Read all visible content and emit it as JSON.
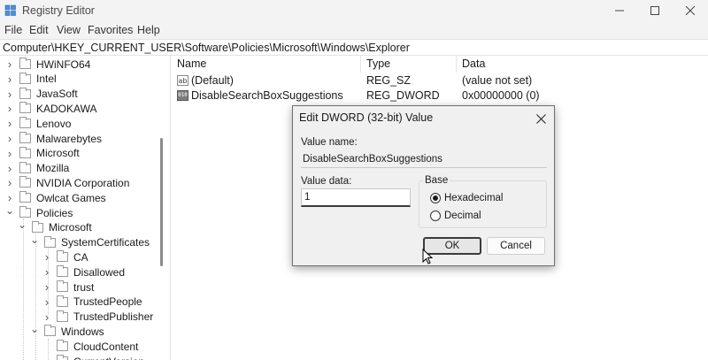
{
  "window": {
    "title": "Registry Editor",
    "minimize_glyph": "—",
    "maximize_glyph": "☐",
    "close_glyph": "✕"
  },
  "menu": [
    "File",
    "Edit",
    "View",
    "Favorites",
    "Help"
  ],
  "address": "Computer\\HKEY_CURRENT_USER\\Software\\Policies\\Microsoft\\Windows\\Explorer",
  "tree": {
    "items": [
      {
        "label": "HWiNFO64",
        "level": 1,
        "state": "collapsed"
      },
      {
        "label": "Intel",
        "level": 1,
        "state": "collapsed"
      },
      {
        "label": "JavaSoft",
        "level": 1,
        "state": "collapsed"
      },
      {
        "label": "KADOKAWA",
        "level": 1,
        "state": "collapsed"
      },
      {
        "label": "Lenovo",
        "level": 1,
        "state": "collapsed"
      },
      {
        "label": "Malwarebytes",
        "level": 1,
        "state": "collapsed"
      },
      {
        "label": "Microsoft",
        "level": 1,
        "state": "collapsed"
      },
      {
        "label": "Mozilla",
        "level": 1,
        "state": "collapsed"
      },
      {
        "label": "NVIDIA Corporation",
        "level": 1,
        "state": "collapsed"
      },
      {
        "label": "Owlcat Games",
        "level": 1,
        "state": "collapsed"
      },
      {
        "label": "Policies",
        "level": 1,
        "state": "expanded"
      },
      {
        "label": "Microsoft",
        "level": 2,
        "state": "expanded"
      },
      {
        "label": "SystemCertificates",
        "level": 3,
        "state": "expanded"
      },
      {
        "label": "CA",
        "level": 4,
        "state": "collapsed"
      },
      {
        "label": "Disallowed",
        "level": 4,
        "state": "collapsed"
      },
      {
        "label": "trust",
        "level": 4,
        "state": "collapsed"
      },
      {
        "label": "TrustedPeople",
        "level": 4,
        "state": "collapsed"
      },
      {
        "label": "TrustedPublisher",
        "level": 4,
        "state": "collapsed"
      },
      {
        "label": "Windows",
        "level": 3,
        "state": "expanded"
      },
      {
        "label": "CloudContent",
        "level": 4,
        "state": "none"
      },
      {
        "label": "CurrentVersion",
        "level": 4,
        "state": "none"
      }
    ]
  },
  "values": {
    "columns": [
      "Name",
      "Type",
      "Data"
    ],
    "rows": [
      {
        "name": "(Default)",
        "type": "REG_SZ",
        "data": "(value not set)",
        "icon": "string-value-icon",
        "icon_text": "ab"
      },
      {
        "name": "DisableSearchBoxSuggestions",
        "type": "REG_DWORD",
        "data": "0x00000000 (0)",
        "icon": "binary-value-icon",
        "icon_text": "010"
      }
    ]
  },
  "dialog": {
    "title": "Edit DWORD (32-bit) Value",
    "value_name_label": "Value name:",
    "value_name": "DisableSearchBoxSuggestions",
    "value_data_label": "Value data:",
    "value_data": "1",
    "base_label": "Base",
    "base_options": [
      {
        "label": "Hexadecimal",
        "checked": true
      },
      {
        "label": "Decimal",
        "checked": false
      }
    ],
    "ok_label": "OK",
    "cancel_label": "Cancel"
  }
}
